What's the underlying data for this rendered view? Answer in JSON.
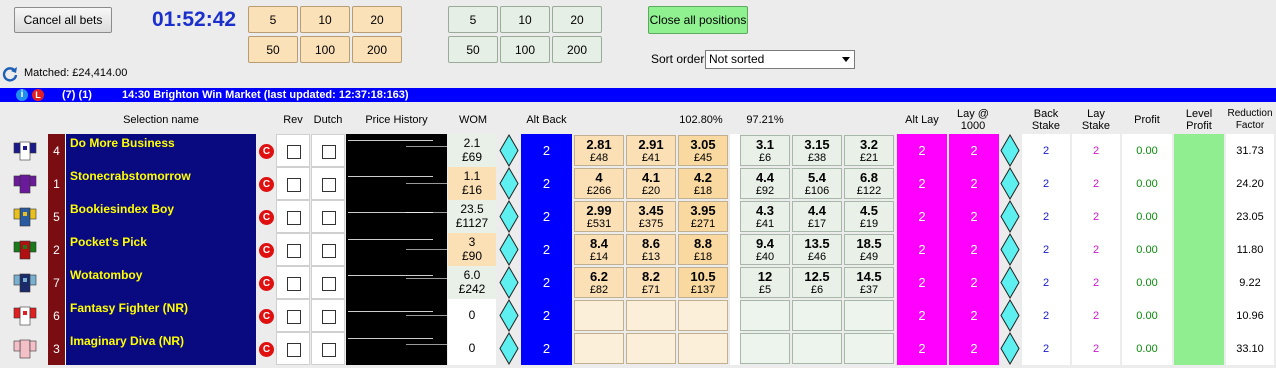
{
  "toolbar": {
    "cancel_all": "Cancel all bets",
    "timer": "01:52:42",
    "back_stakes": [
      "5",
      "10",
      "20",
      "50",
      "100",
      "200"
    ],
    "lay_stakes": [
      "5",
      "10",
      "20",
      "50",
      "100",
      "200"
    ],
    "close_all": "Close all positions",
    "sort_label": "Sort order",
    "sort_value": "Not sorted",
    "matched": "Matched: £24,414.00"
  },
  "market": {
    "counts": "(7) (1)",
    "title": "14:30 Brighton Win Market (last updated: 12:37:18:163)"
  },
  "headers": {
    "selection": "Selection name",
    "rev": "Rev",
    "dutch": "Dutch",
    "price_history": "Price History",
    "wom": "WOM",
    "alt_back": "Alt Back",
    "back_pct": "102.80%",
    "lay_pct": "97.21%",
    "alt_lay": "Alt Lay",
    "lay_1000": "Lay @ 1000",
    "back_stake": "Back Stake",
    "lay_stake": "Lay Stake",
    "profit": "Profit",
    "level_profit": "Level Profit",
    "reduction": "Reduction Factor"
  },
  "colors": {
    "market_bar": "#0000ff",
    "name_bg": "#0a0a80",
    "name_text": "#ffff00",
    "magenta": "#ff00ff"
  },
  "runners": [
    {
      "num": "4",
      "name": "Do More Business",
      "wom": [
        "2.1",
        "£69"
      ],
      "alt_back": "2",
      "back": [
        [
          "2.81",
          "£48"
        ],
        [
          "2.91",
          "£41"
        ],
        [
          "3.05",
          "£45"
        ]
      ],
      "lay": [
        [
          "3.1",
          "£6"
        ],
        [
          "3.15",
          "£38"
        ],
        [
          "3.2",
          "£21"
        ]
      ],
      "alt_lay": "2",
      "lay1000": "2",
      "back_stake": "2",
      "lay_stake": "2",
      "profit": "0.00",
      "rf": "31.73"
    },
    {
      "num": "1",
      "name": "Stonecrabstomorrow",
      "wom": [
        "1.1",
        "£16"
      ],
      "alt_back": "2",
      "back": [
        [
          "4",
          "£266"
        ],
        [
          "4.1",
          "£20"
        ],
        [
          "4.2",
          "£18"
        ]
      ],
      "lay": [
        [
          "4.4",
          "£92"
        ],
        [
          "5.4",
          "£106"
        ],
        [
          "6.8",
          "£122"
        ]
      ],
      "alt_lay": "2",
      "lay1000": "2",
      "back_stake": "2",
      "lay_stake": "2",
      "profit": "0.00",
      "rf": "24.20"
    },
    {
      "num": "5",
      "name": "Bookiesindex Boy",
      "wom": [
        "23.5",
        "£1127"
      ],
      "alt_back": "2",
      "back": [
        [
          "2.99",
          "£531"
        ],
        [
          "3.45",
          "£375"
        ],
        [
          "3.95",
          "£271"
        ]
      ],
      "lay": [
        [
          "4.3",
          "£41"
        ],
        [
          "4.4",
          "£17"
        ],
        [
          "4.5",
          "£19"
        ]
      ],
      "alt_lay": "2",
      "lay1000": "2",
      "back_stake": "2",
      "lay_stake": "2",
      "profit": "0.00",
      "rf": "23.05"
    },
    {
      "num": "2",
      "name": "Pocket's Pick",
      "wom": [
        "3",
        "£90"
      ],
      "alt_back": "2",
      "back": [
        [
          "8.4",
          "£14"
        ],
        [
          "8.6",
          "£13"
        ],
        [
          "8.8",
          "£18"
        ]
      ],
      "lay": [
        [
          "9.4",
          "£40"
        ],
        [
          "13.5",
          "£46"
        ],
        [
          "18.5",
          "£49"
        ]
      ],
      "alt_lay": "2",
      "lay1000": "2",
      "back_stake": "2",
      "lay_stake": "2",
      "profit": "0.00",
      "rf": "11.80"
    },
    {
      "num": "7",
      "name": "Wotatomboy",
      "wom": [
        "6.0",
        "£242"
      ],
      "alt_back": "2",
      "back": [
        [
          "6.2",
          "£82"
        ],
        [
          "8.2",
          "£71"
        ],
        [
          "10.5",
          "£137"
        ]
      ],
      "lay": [
        [
          "12",
          "£5"
        ],
        [
          "12.5",
          "£6"
        ],
        [
          "14.5",
          "£37"
        ]
      ],
      "alt_lay": "2",
      "lay1000": "2",
      "back_stake": "2",
      "lay_stake": "2",
      "profit": "0.00",
      "rf": "9.22"
    },
    {
      "num": "6",
      "name": "Fantasy Fighter (NR)",
      "wom": [
        "0",
        ""
      ],
      "alt_back": "2",
      "back": [
        [
          "",
          ""
        ],
        [
          "",
          ""
        ],
        [
          "",
          ""
        ]
      ],
      "lay": [
        [
          "",
          ""
        ],
        [
          "",
          ""
        ],
        [
          "",
          ""
        ]
      ],
      "alt_lay": "2",
      "lay1000": "2",
      "back_stake": "2",
      "lay_stake": "2",
      "profit": "0.00",
      "rf": "10.96"
    },
    {
      "num": "3",
      "name": "Imaginary Diva (NR)",
      "wom": [
        "0",
        ""
      ],
      "alt_back": "2",
      "back": [
        [
          "",
          ""
        ],
        [
          "",
          ""
        ],
        [
          "",
          ""
        ]
      ],
      "lay": [
        [
          "",
          ""
        ],
        [
          "",
          ""
        ],
        [
          "",
          ""
        ]
      ],
      "alt_lay": "2",
      "lay1000": "2",
      "back_stake": "2",
      "lay_stake": "2",
      "profit": "0.00",
      "rf": "33.10"
    }
  ]
}
